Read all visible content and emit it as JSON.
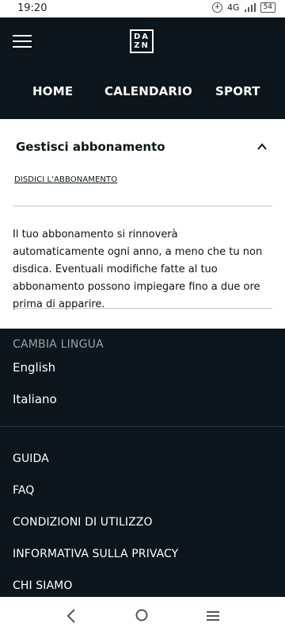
{
  "status_bar": {
    "time": "19:20",
    "network": "4G",
    "battery": "54"
  },
  "header": {
    "logo_line1": "DA",
    "logo_line2": "ZN",
    "nav": {
      "home": "HOME",
      "calendar": "CALENDARIO",
      "sport": "SPORT"
    }
  },
  "subscription": {
    "title": "Gestisci abbonamento",
    "cancel_link": "DISDICI L'ABBONAMENTO",
    "renewal_text": "Il tuo abbonamento si rinnoverà automaticamente ogni anno, a meno che tu non disdica. Eventuali modifiche fatte al tuo abbonamento possono impiegare fino a due ore prima di apparire."
  },
  "language": {
    "heading": "CAMBIA LINGUA",
    "options": [
      "English",
      "Italiano"
    ]
  },
  "footer_links": [
    "GUIDA",
    "FAQ",
    "CONDIZIONI DI UTILIZZO",
    "INFORMATIVA SULLA PRIVACY",
    "CHI SIAMO"
  ],
  "colors": {
    "background": "#0c161c",
    "panel": "#ffffff",
    "muted_text": "#9aa2a6"
  }
}
